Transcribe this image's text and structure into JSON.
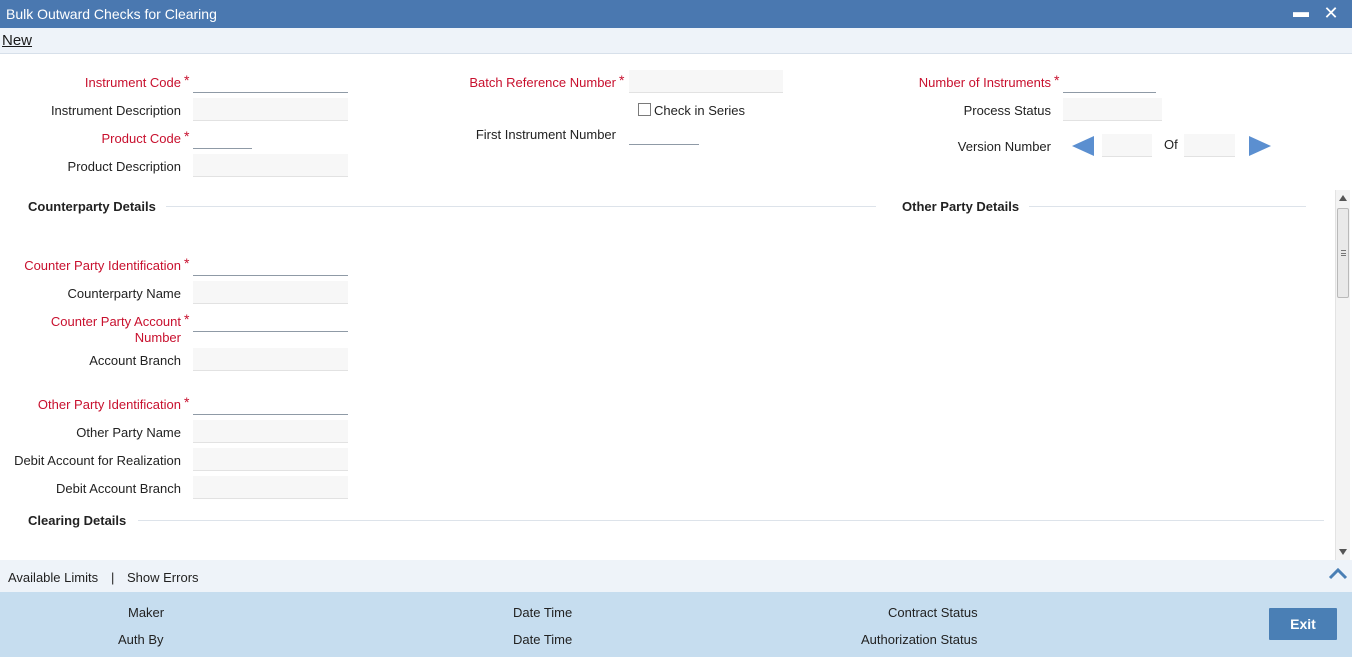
{
  "window": {
    "title": "Bulk Outward Checks for Clearing",
    "minimize_label": "▬",
    "close_label": "✕"
  },
  "toolbar": {
    "new_label": "New"
  },
  "header": {
    "instrument_code_label": "Instrument Code",
    "instrument_description_label": "Instrument Description",
    "product_code_label": "Product Code",
    "product_description_label": "Product Description",
    "batch_reference_label": "Batch Reference Number",
    "check_in_series_label": "Check in Series",
    "first_instrument_label": "First Instrument Number",
    "number_of_instruments_label": "Number of Instruments",
    "process_status_label": "Process Status",
    "version_number_label": "Version Number",
    "of_label": "Of",
    "required_marker": "*"
  },
  "counterparty": {
    "section_title": "Counterparty Details",
    "identification_label": "Counter Party Identification",
    "name_label": "Counterparty Name",
    "account_number_label_line1": "Counter Party Account",
    "account_number_label_line2": "Number",
    "account_branch_label": "Account Branch",
    "other_party_identification_label": "Other Party Identification",
    "other_party_name_label": "Other Party Name",
    "debit_account_label": "Debit Account for Realization",
    "debit_account_branch_label": "Debit Account Branch"
  },
  "other_party": {
    "section_title": "Other Party Details"
  },
  "clearing": {
    "section_title": "Clearing Details"
  },
  "links": {
    "available_limits": "Available Limits",
    "separator": "|",
    "show_errors": "Show Errors"
  },
  "footer": {
    "maker_label": "Maker",
    "date_time_label_1": "Date Time",
    "contract_status_label": "Contract Status",
    "auth_by_label": "Auth By",
    "date_time_label_2": "Date Time",
    "authorization_status_label": "Authorization Status",
    "exit_label": "Exit"
  },
  "colors": {
    "title_bar": "#4a78b0",
    "required_label": "#c8102e",
    "footer_bg": "#c6ddef",
    "exit_button": "#4a7fb5",
    "nav_arrow": "#5b8fd0"
  },
  "icons": [
    "minimize-icon",
    "close-icon",
    "version-prev-icon",
    "version-next-icon",
    "scroll-up-icon",
    "scroll-down-icon",
    "collapse-chevron-up-icon"
  ]
}
